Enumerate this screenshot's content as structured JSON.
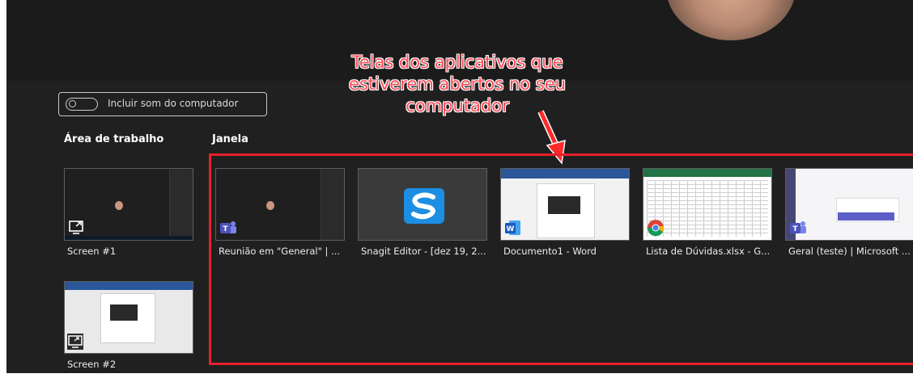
{
  "sound_toggle": {
    "label": "Incluir som do computador",
    "state": "off"
  },
  "annotation": {
    "lines": [
      "Telas dos aplicativos que",
      "estiverem abertos no seu",
      "computador"
    ]
  },
  "sections": {
    "desktop": "Área de trabalho",
    "window": "Janela"
  },
  "screens": [
    {
      "label": "Screen #1",
      "icon": "share-screen-icon"
    },
    {
      "label": "Screen #2",
      "icon": "share-screen-icon"
    }
  ],
  "windows": [
    {
      "label": "Reunião em \"General\" | ...",
      "app_icon": "teams-icon"
    },
    {
      "label": "Snagit Editor - [dez 19, 2...",
      "app_icon": "snagit-icon"
    },
    {
      "label": "Documento1 - Word",
      "app_icon": "word-icon"
    },
    {
      "label": "Lista de Dúvidas.xlsx - G...",
      "app_icon": "chrome-icon"
    },
    {
      "label": "Geral (teste) | Microsoft ...",
      "app_icon": "teams-icon"
    }
  ],
  "colors": {
    "annotation": "#ff4b56",
    "highlight_border": "#e8202a",
    "background": "#202020"
  }
}
